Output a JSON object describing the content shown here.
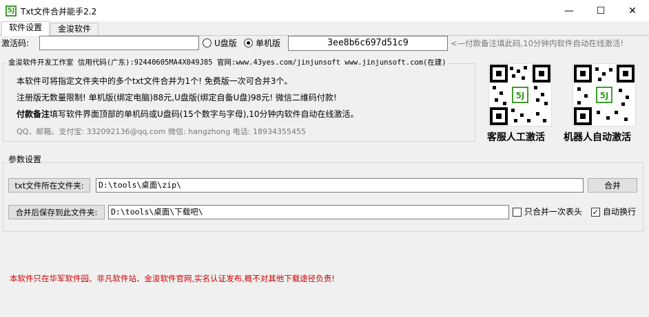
{
  "window": {
    "title": "Txt文件合并能手2.2",
    "app_icon_glyph": "5J",
    "minimize_glyph": "—",
    "maximize_glyph": "☐",
    "close_glyph": "✕"
  },
  "tabs": [
    {
      "label": "软件设置",
      "active": true
    },
    {
      "label": "金浚软件",
      "active": false
    }
  ],
  "activation": {
    "label": "激活码:",
    "value": "",
    "radio_udisk": "U盘版",
    "radio_single": "单机版",
    "selected": "单机版",
    "machine_code": "3ee8b6c697d51c9",
    "hint": "<—付款备注填此码,10分钟内软件自动在线激活!"
  },
  "info": {
    "group_title": "金浚软件开发工作室 信用代码(广东):92440605MA4X049J85 官网:www.43yes.com/jinjunsoft  www.jinjunsoft.com(在建)",
    "line1": "本软件可将指定文件夹中的多个txt文件合并为1个! 免费版一次可合并3个。",
    "line2": "注册版无数量限制! 单机版(绑定电脑)88元,U盘版(绑定自备U盘)98元! 微信二维码付款!",
    "line3_bold": "付款备注",
    "line3_rest": "填写软件界面顶部的单机码或U盘码(15个数字与字母),10分钟内软件自动在线激活。",
    "contact": "QQ、邮箱、支付宝: 332092136@qq.com   微信: hangzhong   电话: 18934355455"
  },
  "qr_codes": [
    {
      "caption": "客服人工激活",
      "icon": "qr-code-icon"
    },
    {
      "caption": "机器人自动激活",
      "icon": "qr-code-icon"
    }
  ],
  "params": {
    "group_title": "参数设置",
    "source_label": "txt文件所在文件夹:",
    "source_value": "D:\\tools\\桌面\\zip\\",
    "merge_button": "合并",
    "dest_label": "合并后保存到此文件夹:",
    "dest_value": "D:\\tools\\桌面\\下载吧\\",
    "opt_header_once": {
      "label": "只合并一次表头",
      "checked": false
    },
    "opt_auto_wrap": {
      "label": "自动换行",
      "checked": true
    }
  },
  "footer_notice": "本软件只在华军软件园、非凡软件站、金浚软件官网,实名认证发布,概不对其他下载途径负责!",
  "colors": {
    "notice_red": "#cc0000",
    "brand_green": "#3c9d2c",
    "hint_gray": "#777777"
  }
}
